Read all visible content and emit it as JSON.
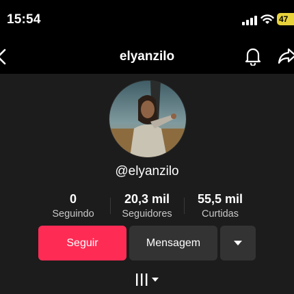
{
  "status_bar": {
    "time": "15:54",
    "battery": "47"
  },
  "header": {
    "title": "elyanzilo"
  },
  "profile": {
    "handle": "@elyanzilo",
    "stats": [
      {
        "value": "0",
        "label": "Seguindo"
      },
      {
        "value": "20,3 mil",
        "label": "Seguidores"
      },
      {
        "value": "55,5 mil",
        "label": "Curtidas"
      }
    ]
  },
  "actions": {
    "follow_label": "Seguir",
    "message_label": "Mensagem"
  },
  "colors": {
    "follow": "#fe2c55",
    "panel": "#1c1c1c",
    "secondary_button": "#333333",
    "battery": "#e8d23b"
  },
  "icons": [
    "back-icon",
    "bell-icon",
    "share-icon",
    "chevron-down-icon",
    "videos-tab-icon"
  ]
}
